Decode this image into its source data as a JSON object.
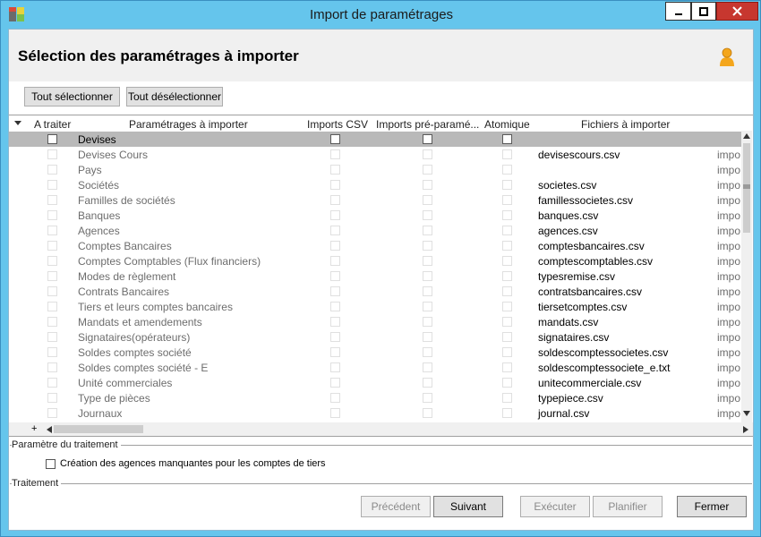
{
  "window": {
    "title": "Import de paramétrages",
    "colors": {
      "titlebar": "#65c5ec",
      "close": "#c7372f"
    },
    "icons": [
      "app-icon",
      "minimize-icon",
      "maximize-icon",
      "close-icon"
    ]
  },
  "header": {
    "title": "Sélection des paramétrages à importer",
    "icon": "user-icon"
  },
  "toolbar": {
    "select_all": "Tout sélectionner",
    "deselect_all": "Tout désélectionner"
  },
  "grid": {
    "columns": [
      "A traiter",
      "Paramétrages à importer",
      "Imports CSV",
      "Imports pré-paramé...",
      "Atomique",
      "Fichiers à importer"
    ],
    "rows": [
      {
        "name": "Devises",
        "file": "",
        "extra": ""
      },
      {
        "name": "Devises Cours",
        "file": "devisescours.csv",
        "extra": "impo"
      },
      {
        "name": "Pays",
        "file": "",
        "extra": "impo"
      },
      {
        "name": "Sociétés",
        "file": "societes.csv",
        "extra": "impo"
      },
      {
        "name": "Familles de sociétés",
        "file": "famillessocietes.csv",
        "extra": "impo"
      },
      {
        "name": "Banques",
        "file": "banques.csv",
        "extra": "impo"
      },
      {
        "name": "Agences",
        "file": "agences.csv",
        "extra": "impo"
      },
      {
        "name": "Comptes Bancaires",
        "file": "comptesbancaires.csv",
        "extra": "impo"
      },
      {
        "name": "Comptes Comptables (Flux financiers)",
        "file": "comptescomptables.csv",
        "extra": "impo"
      },
      {
        "name": "Modes de règlement",
        "file": "typesremise.csv",
        "extra": "impo"
      },
      {
        "name": "Contrats Bancaires",
        "file": "contratsbancaires.csv",
        "extra": "impo"
      },
      {
        "name": "Tiers et leurs comptes bancaires",
        "file": "tiersetcomptes.csv",
        "extra": "impo"
      },
      {
        "name": "Mandats et amendements",
        "file": "mandats.csv",
        "extra": "impo"
      },
      {
        "name": "Signataires(opérateurs)",
        "file": "signataires.csv",
        "extra": "impo"
      },
      {
        "name": "Soldes comptes société",
        "file": "soldescomptessocietes.csv",
        "extra": "impo"
      },
      {
        "name": "Soldes comptes société - E",
        "file": "soldescomptessociete_e.txt",
        "extra": "impo"
      },
      {
        "name": "Unité commerciales",
        "file": "unitecommerciale.csv",
        "extra": "impo"
      },
      {
        "name": "Type de pièces",
        "file": "typepiece.csv",
        "extra": "impo"
      },
      {
        "name": "Journaux",
        "file": "journal.csv",
        "extra": "impo"
      }
    ],
    "selected_row": 0
  },
  "params": {
    "group_label": "Paramètre du traitement",
    "checkbox_label": "Création des agences manquantes pour les comptes de tiers"
  },
  "treatment": {
    "group_label": "Traitement",
    "buttons": {
      "previous": "Précédent",
      "next": "Suivant",
      "execute": "Exécuter",
      "schedule": "Planifier",
      "close": "Fermer"
    }
  }
}
